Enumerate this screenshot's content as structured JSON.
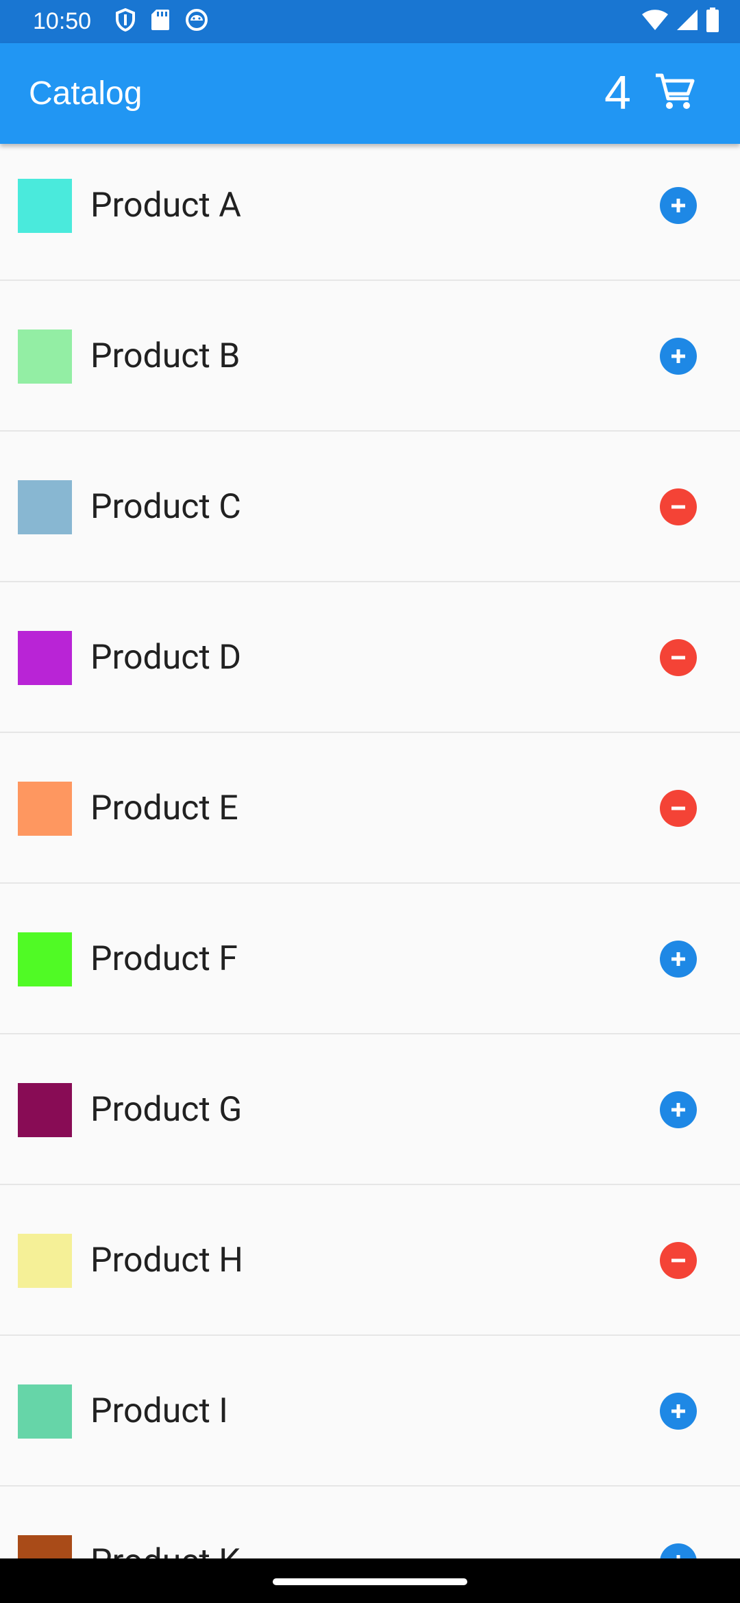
{
  "status_bar": {
    "time": "10:50",
    "left_icons": [
      "shield-icon",
      "sd-card-icon",
      "android-debug-icon"
    ],
    "right_icons": [
      "wifi-icon",
      "cell-signal-icon",
      "battery-icon"
    ]
  },
  "app_bar": {
    "title": "Catalog",
    "cart_count": "4",
    "cart_icon": "shopping-cart-icon"
  },
  "colors": {
    "status_bar": "#1976d2",
    "app_bar": "#2196f3",
    "add": "#1e88e5",
    "remove": "#f44336"
  },
  "products": [
    {
      "name": "Product A",
      "color": "#4aeadc",
      "in_cart": false
    },
    {
      "name": "Product B",
      "color": "#93eea4",
      "in_cart": false
    },
    {
      "name": "Product C",
      "color": "#88b7d2",
      "in_cart": true
    },
    {
      "name": "Product D",
      "color": "#b924d6",
      "in_cart": true
    },
    {
      "name": "Product E",
      "color": "#fe9760",
      "in_cart": true
    },
    {
      "name": "Product F",
      "color": "#50fa25",
      "in_cart": false
    },
    {
      "name": "Product G",
      "color": "#880c55",
      "in_cart": false
    },
    {
      "name": "Product H",
      "color": "#f5f097",
      "in_cart": true
    },
    {
      "name": "Product I",
      "color": "#66d5a8",
      "in_cart": false
    },
    {
      "name": "Product K",
      "color": "#a94b18",
      "in_cart": false
    }
  ]
}
